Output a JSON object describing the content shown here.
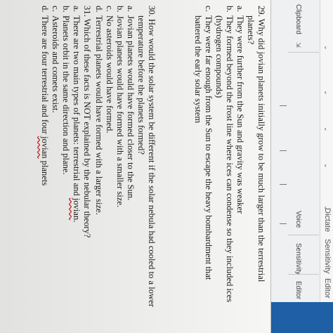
{
  "ribbon": {
    "clipboard_label": "Clipboard",
    "dictate_label": "Dictate",
    "voice_label": "Voice",
    "sensitivity_label": "Sensitivity",
    "editor_label_top": "Editor",
    "editor_label_bottom": "Editor",
    "accent_color": "#1f5fa6",
    "icon_launcher": "dialog-launcher-icon"
  },
  "document": {
    "q29": {
      "number": "29.",
      "stem_line1": "Why did jovian planets initially grow to be much larger than the terrestrial",
      "stem_line2": "planets?",
      "options": [
        {
          "letter": "a.",
          "line1": "They were further from the Sun and gravity was weaker",
          "line2": ""
        },
        {
          "letter": "b.",
          "line1": "They formed beyond the frost line where ices can condense so they included ices",
          "line2": "(hydrogen compounds)"
        },
        {
          "letter": "c.",
          "line1": "They were far enough from the Sun to escape the heavy bombardment that",
          "line2": "battered the early solar system"
        }
      ]
    },
    "q30": {
      "number": "30.",
      "stem_line1": "How would the solar system be different if the solar nebula had cooled to a lower",
      "stem_line2": "temperature before the planets formed?",
      "options": [
        {
          "letter": "a.",
          "text": "Jovian planets would have formed closer to the Sun."
        },
        {
          "letter": "b.",
          "text": "Jovian planets would have formed with a smaller size."
        },
        {
          "letter": "c.",
          "text": "No asteroids would have formed."
        },
        {
          "letter": "d.",
          "text": "Terrestrial planets would have formed with a larger size."
        }
      ]
    },
    "q31": {
      "number": "31.",
      "stem": "Which of these facts is NOT explained by the nebular theory?",
      "options": [
        {
          "letter": "a.",
          "text_before": "There are two main types of planets: terrestrial and ",
          "misspelled": "jovian",
          "text_after": "."
        },
        {
          "letter": "b.",
          "text_before": "Planets orbit in the same direction and plane.",
          "misspelled": "",
          "text_after": ""
        },
        {
          "letter": "c.",
          "text_before": "Asteroids and comets exist.",
          "misspelled": "",
          "text_after": ""
        },
        {
          "letter": "d.",
          "text_before": "There are four terrestrial and four ",
          "misspelled": "jovian",
          "text_after": " planets"
        }
      ]
    }
  }
}
